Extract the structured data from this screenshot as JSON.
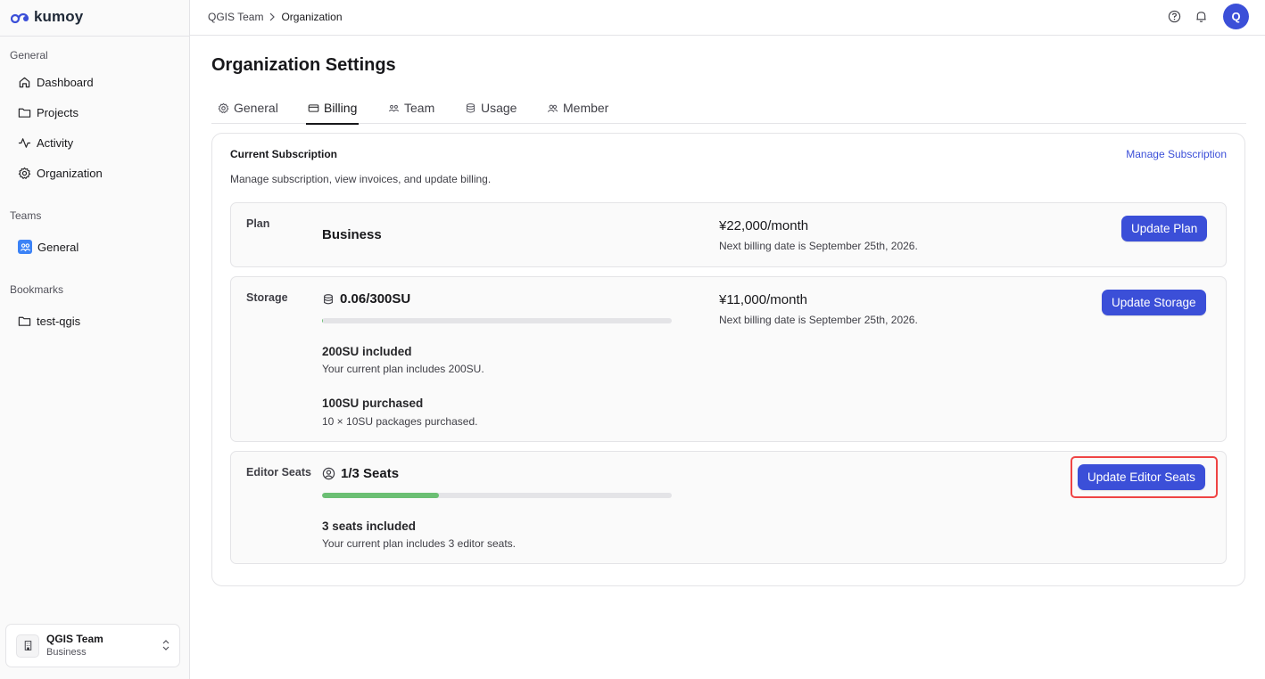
{
  "brand": {
    "name": "kumoy",
    "color": "#3b4fd8"
  },
  "sidebar": {
    "general_label": "General",
    "items": [
      {
        "label": "Dashboard",
        "icon": "home-icon"
      },
      {
        "label": "Projects",
        "icon": "folder-icon"
      },
      {
        "label": "Activity",
        "icon": "activity-icon"
      },
      {
        "label": "Organization",
        "icon": "gear-icon"
      }
    ],
    "teams_label": "Teams",
    "teams": [
      {
        "label": "General",
        "icon": "team-icon"
      }
    ],
    "bookmarks_label": "Bookmarks",
    "bookmarks": [
      {
        "label": "test-qgis",
        "icon": "folder-icon"
      }
    ],
    "team_switcher": {
      "name": "QGIS Team",
      "plan": "Business"
    }
  },
  "header": {
    "breadcrumb": [
      "QGIS Team",
      "Organization"
    ],
    "avatar_initial": "Q"
  },
  "page": {
    "title": "Organization Settings",
    "tabs": [
      {
        "label": "General",
        "icon": "gear-icon",
        "active": false
      },
      {
        "label": "Billing",
        "icon": "credit-card-icon",
        "active": true
      },
      {
        "label": "Team",
        "icon": "team-icon",
        "active": false
      },
      {
        "label": "Usage",
        "icon": "database-icon",
        "active": false
      },
      {
        "label": "Member",
        "icon": "users-icon",
        "active": false
      }
    ]
  },
  "subscription": {
    "title": "Current Subscription",
    "manage_link": "Manage Subscription",
    "description": "Manage subscription, view invoices, and update billing.",
    "plan": {
      "label": "Plan",
      "name": "Business",
      "price": "¥22,000/month",
      "next_billing": "Next billing date is September 25th, 2026.",
      "button": "Update Plan"
    },
    "storage": {
      "label": "Storage",
      "usage": "0.06/300SU",
      "usage_fraction": 0.0002,
      "price": "¥11,000/month",
      "next_billing": "Next billing date is September 25th, 2026.",
      "button": "Update Storage",
      "included_title": "200SU included",
      "included_sub": "Your current plan includes 200SU.",
      "purchased_title": "100SU purchased",
      "purchased_sub": "10 × 10SU packages purchased."
    },
    "seats": {
      "label": "Editor Seats",
      "usage": "1/3 Seats",
      "usage_fraction": 0.3333,
      "button": "Update Editor Seats",
      "included_title": "3 seats included",
      "included_sub": "Your current plan includes 3 editor seats.",
      "bar_color": "#6bbf73"
    }
  }
}
